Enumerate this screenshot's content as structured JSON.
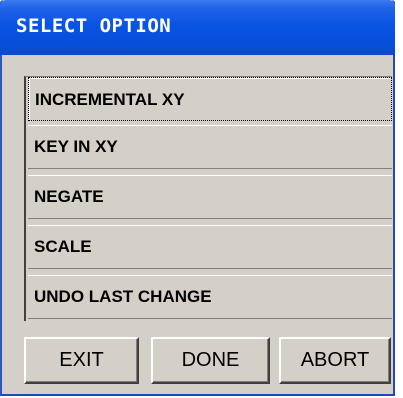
{
  "window": {
    "title": "SELECT OPTION"
  },
  "options": [
    {
      "label": "INCREMENTAL XY",
      "selected": true
    },
    {
      "label": "KEY IN XY",
      "selected": false
    },
    {
      "label": "NEGATE",
      "selected": false
    },
    {
      "label": "SCALE",
      "selected": false
    },
    {
      "label": "UNDO LAST CHANGE",
      "selected": false
    }
  ],
  "buttons": {
    "exit": "EXIT",
    "done": "DONE",
    "abort": "ABORT"
  },
  "colors": {
    "titlebar": "#0a54e3",
    "face": "#d4d0c8",
    "title_text": "#ffffff"
  }
}
